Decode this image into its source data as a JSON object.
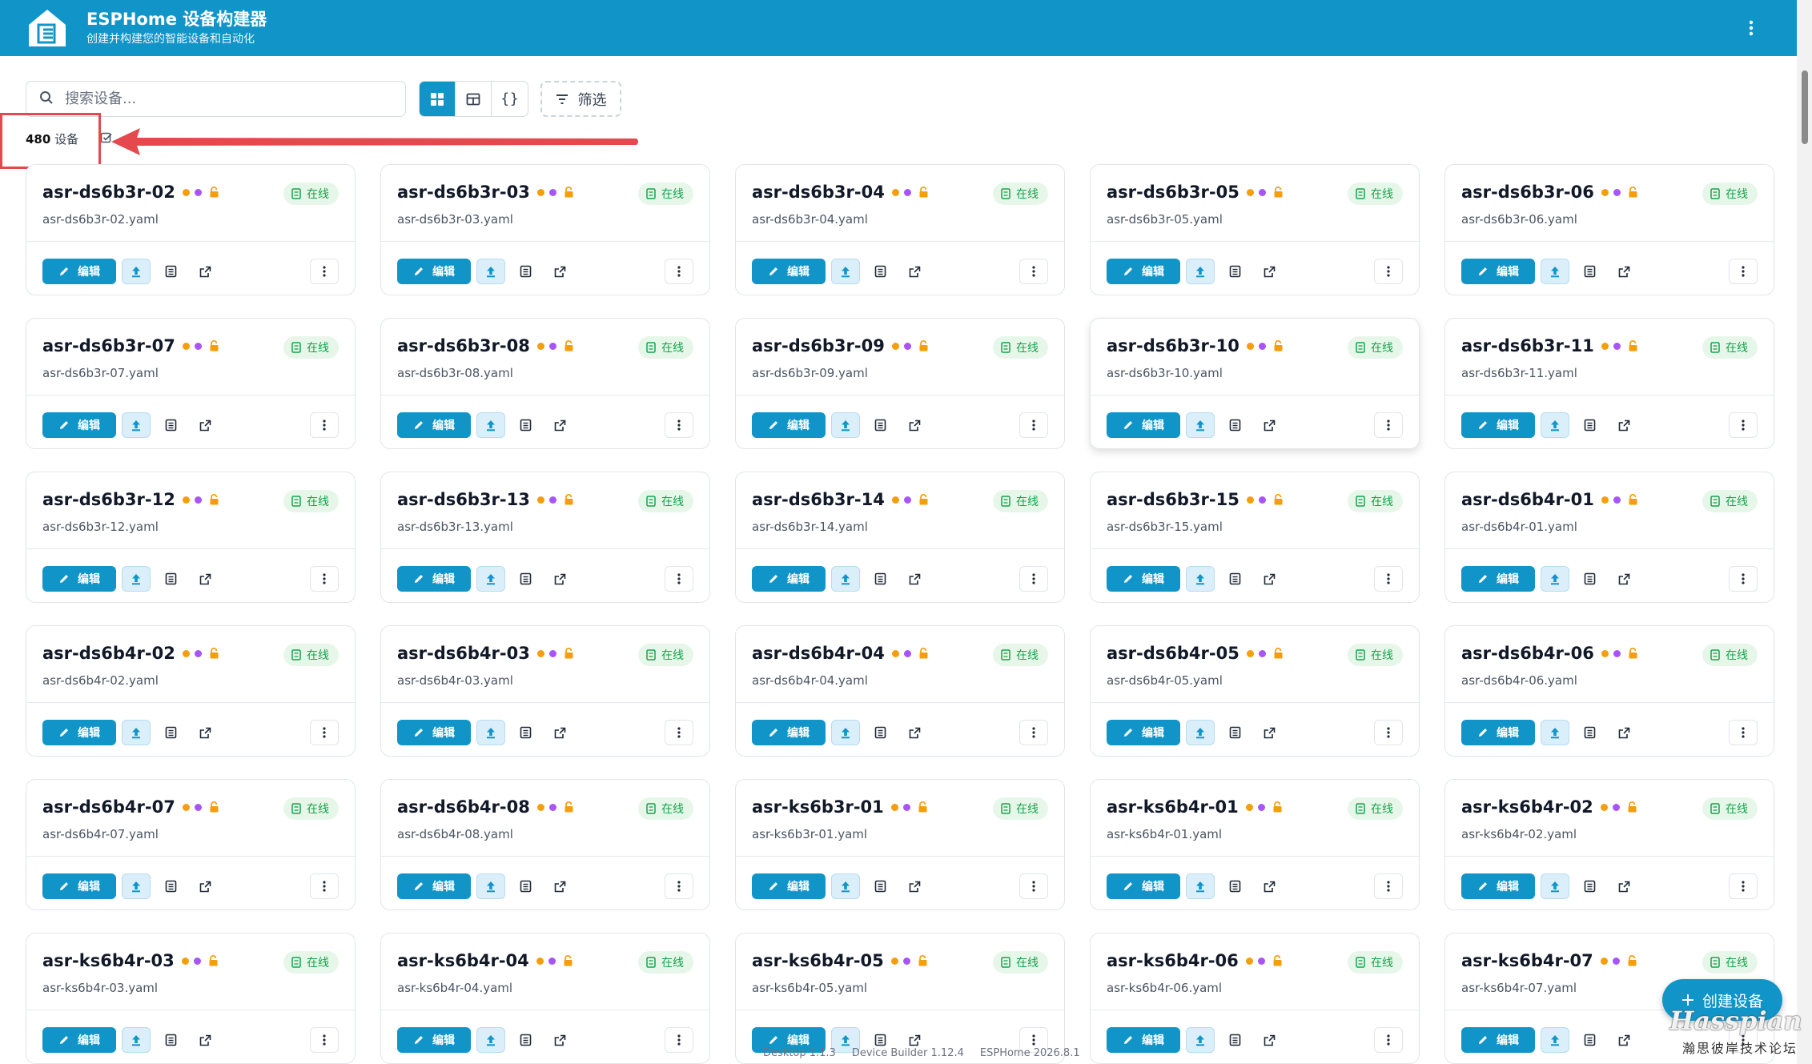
{
  "header": {
    "title": "ESPHome 设备构建器",
    "subtitle": "创建并构建您的智能设备和自动化",
    "logo_icon": "esphome-logo-icon",
    "menu_icon": "more-vertical-icon"
  },
  "toolbar": {
    "search_placeholder": "搜索设备...",
    "views": [
      {
        "icon": "grid-view-icon",
        "active": true
      },
      {
        "icon": "table-view-icon",
        "active": false
      },
      {
        "icon": "code-braces-icon",
        "label": "{}",
        "active": false
      }
    ],
    "filter_label": "筛选"
  },
  "summary": {
    "count": "480",
    "unit": "设备"
  },
  "card_common": {
    "edit_label": "编辑",
    "status_label": "在线"
  },
  "devices": [
    {
      "name": "asr-ds6b3r-02",
      "file": "asr-ds6b3r-02.yaml"
    },
    {
      "name": "asr-ds6b3r-03",
      "file": "asr-ds6b3r-03.yaml"
    },
    {
      "name": "asr-ds6b3r-04",
      "file": "asr-ds6b3r-04.yaml"
    },
    {
      "name": "asr-ds6b3r-05",
      "file": "asr-ds6b3r-05.yaml"
    },
    {
      "name": "asr-ds6b3r-06",
      "file": "asr-ds6b3r-06.yaml"
    },
    {
      "name": "asr-ds6b3r-07",
      "file": "asr-ds6b3r-07.yaml"
    },
    {
      "name": "asr-ds6b3r-08",
      "file": "asr-ds6b3r-08.yaml"
    },
    {
      "name": "asr-ds6b3r-09",
      "file": "asr-ds6b3r-09.yaml"
    },
    {
      "name": "asr-ds6b3r-10",
      "file": "asr-ds6b3r-10.yaml",
      "hovered": true
    },
    {
      "name": "asr-ds6b3r-11",
      "file": "asr-ds6b3r-11.yaml"
    },
    {
      "name": "asr-ds6b3r-12",
      "file": "asr-ds6b3r-12.yaml"
    },
    {
      "name": "asr-ds6b3r-13",
      "file": "asr-ds6b3r-13.yaml"
    },
    {
      "name": "asr-ds6b3r-14",
      "file": "asr-ds6b3r-14.yaml"
    },
    {
      "name": "asr-ds6b3r-15",
      "file": "asr-ds6b3r-15.yaml"
    },
    {
      "name": "asr-ds6b4r-01",
      "file": "asr-ds6b4r-01.yaml"
    },
    {
      "name": "asr-ds6b4r-02",
      "file": "asr-ds6b4r-02.yaml"
    },
    {
      "name": "asr-ds6b4r-03",
      "file": "asr-ds6b4r-03.yaml"
    },
    {
      "name": "asr-ds6b4r-04",
      "file": "asr-ds6b4r-04.yaml"
    },
    {
      "name": "asr-ds6b4r-05",
      "file": "asr-ds6b4r-05.yaml"
    },
    {
      "name": "asr-ds6b4r-06",
      "file": "asr-ds6b4r-06.yaml"
    },
    {
      "name": "asr-ds6b4r-07",
      "file": "asr-ds6b4r-07.yaml"
    },
    {
      "name": "asr-ds6b4r-08",
      "file": "asr-ds6b4r-08.yaml"
    },
    {
      "name": "asr-ks6b3r-01",
      "file": "asr-ks6b3r-01.yaml"
    },
    {
      "name": "asr-ks6b4r-01",
      "file": "asr-ks6b4r-01.yaml"
    },
    {
      "name": "asr-ks6b4r-02",
      "file": "asr-ks6b4r-02.yaml"
    },
    {
      "name": "asr-ks6b4r-03",
      "file": "asr-ks6b4r-03.yaml"
    },
    {
      "name": "asr-ks6b4r-04",
      "file": "asr-ks6b4r-04.yaml"
    },
    {
      "name": "asr-ks6b4r-05",
      "file": "asr-ks6b4r-05.yaml"
    },
    {
      "name": "asr-ks6b4r-06",
      "file": "asr-ks6b4r-06.yaml"
    },
    {
      "name": "asr-ks6b4r-07",
      "file": "asr-ks6b4r-07.yaml"
    }
  ],
  "footer": {
    "desktop": "Desktop 1.1.3",
    "builder": "Device Builder 1.12.4",
    "esphome": "ESPHome 2026.8.1"
  },
  "fab": {
    "label": "创建设备",
    "icon": "plus-icon"
  },
  "watermark": {
    "main": "Hasspian",
    "sub": "瀚思彼岸技术论坛"
  },
  "colors": {
    "brand": "#1195c8",
    "online_bg": "#e6f7ea",
    "online_text": "#16a34a",
    "dot_orange": "#f59e0b",
    "dot_purple": "#a855f7",
    "annotation_red": "#e5484d"
  }
}
